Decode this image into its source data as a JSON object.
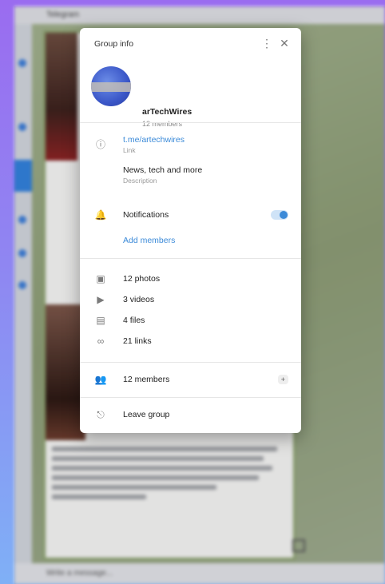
{
  "background_app": {
    "title": "Telegram",
    "bottom_bar_text": "Write a message..."
  },
  "popup": {
    "title": "Group info",
    "more_icon": "more-vertical-icon",
    "close_icon": "close-icon",
    "profile": {
      "name": "arTechWires",
      "status": "12 members"
    },
    "info": {
      "link_label": "t.me/artechwires",
      "link_sub": "Link",
      "description_label": "News, tech and more",
      "description_sub": "Description"
    },
    "notifications": {
      "label": "Notifications",
      "enabled": true,
      "add_members_link": "Add members"
    },
    "counts": [
      {
        "icon": "photo-icon",
        "label": "12 photos"
      },
      {
        "icon": "video-icon",
        "label": "3 videos"
      },
      {
        "icon": "file-icon",
        "label": "4 files"
      },
      {
        "icon": "link-icon",
        "label": "21 links"
      }
    ],
    "members": {
      "icon": "members-icon",
      "label": "12 members",
      "badge": "+"
    },
    "leave": {
      "icon": "leave-icon",
      "label": "Leave group"
    }
  },
  "colors": {
    "accent": "#3b8ad8",
    "background_top": "#9a6cf0",
    "background_bottom": "#7fb0f6"
  }
}
